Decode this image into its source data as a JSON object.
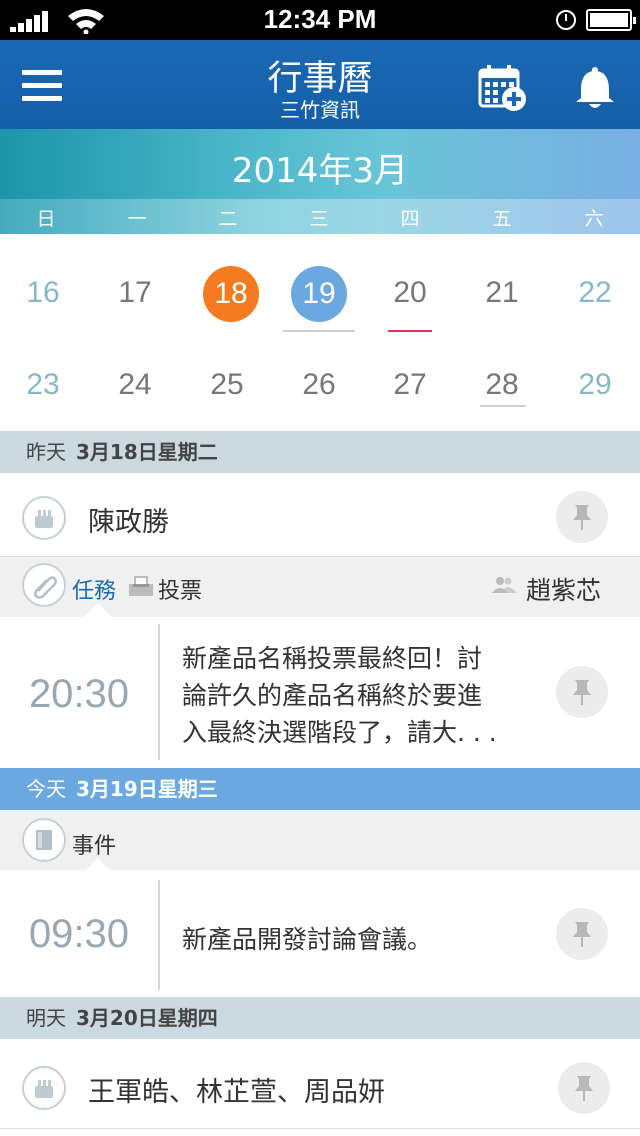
{
  "status_bar": {
    "time": "12:34 PM"
  },
  "nav": {
    "title": "行事曆",
    "subtitle": "三竹資訊"
  },
  "month": {
    "title": "2014年3月"
  },
  "weekdays": [
    "日",
    "一",
    "二",
    "三",
    "四",
    "五",
    "六"
  ],
  "week1": [
    "16",
    "17",
    "18",
    "19",
    "20",
    "21",
    "22"
  ],
  "week2": [
    "23",
    "24",
    "25",
    "26",
    "27",
    "28",
    "29"
  ],
  "colors": {
    "selected": "#f47b20",
    "today": "#6aa8df",
    "accent": "#1b69b4",
    "event_mark": "#d9395a"
  },
  "sections": [
    {
      "prefix": "昨天",
      "date": "3月18日星期二"
    },
    {
      "prefix": "今天",
      "date": "3月19日星期三"
    },
    {
      "prefix": "明天",
      "date": "3月20日星期四"
    }
  ],
  "yesterday": {
    "birthday": "陳政勝",
    "tabs": {
      "task": "任務",
      "vote": "投票",
      "owner": "趙紫芯"
    },
    "event": {
      "time": "20:30",
      "lines": [
        "新產品名稱投票最終回！討",
        "論許久的產品名稱終於要進",
        "入最終決選階段了，請大. . ."
      ]
    }
  },
  "today": {
    "tab": "事件",
    "event": {
      "time": "09:30",
      "text": "新產品開發討論會議。"
    }
  },
  "tomorrow": {
    "birthday": "王軍皓、林芷萱、周品妍"
  }
}
